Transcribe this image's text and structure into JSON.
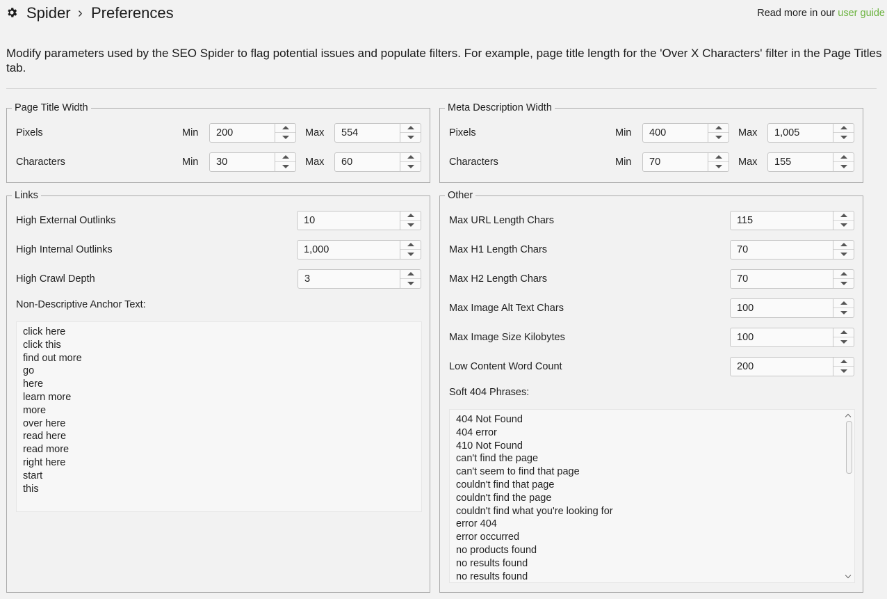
{
  "header": {
    "crumb_root": "Spider",
    "crumb_separator": "›",
    "crumb_page": "Preferences",
    "read_more_prefix": "Read more in our",
    "read_more_link": "user guide",
    "link_color": "#6cb33f"
  },
  "description": "Modify parameters used by the SEO Spider to flag potential issues and populate filters. For example, page title length for the 'Over X Characters' filter in the Page Titles tab.",
  "page_title_width": {
    "title": "Page Title Width",
    "rows": [
      {
        "label": "Pixels",
        "min_label": "Min",
        "min": "200",
        "max_label": "Max",
        "max": "554"
      },
      {
        "label": "Characters",
        "min_label": "Min",
        "min": "30",
        "max_label": "Max",
        "max": "60"
      }
    ]
  },
  "meta_description_width": {
    "title": "Meta Description Width",
    "rows": [
      {
        "label": "Pixels",
        "min_label": "Min",
        "min": "400",
        "max_label": "Max",
        "max": "1,005"
      },
      {
        "label": "Characters",
        "min_label": "Min",
        "min": "70",
        "max_label": "Max",
        "max": "155"
      }
    ]
  },
  "links": {
    "title": "Links",
    "fields": [
      {
        "label": "High External Outlinks",
        "value": "10"
      },
      {
        "label": "High Internal Outlinks",
        "value": "1,000"
      },
      {
        "label": "High Crawl Depth",
        "value": "3"
      }
    ],
    "anchor_label": "Non-Descriptive Anchor Text:",
    "anchor_text": [
      "click here",
      "click this",
      "find out more",
      "go",
      "here",
      "learn more",
      "more",
      "over here",
      "read here",
      "read more",
      "right here",
      "start",
      "this"
    ]
  },
  "other": {
    "title": "Other",
    "fields": [
      {
        "label": "Max URL Length Chars",
        "value": "115"
      },
      {
        "label": "Max H1 Length Chars",
        "value": "70"
      },
      {
        "label": "Max H2 Length Chars",
        "value": "70"
      },
      {
        "label": "Max Image Alt Text Chars",
        "value": "100"
      },
      {
        "label": "Max Image Size Kilobytes",
        "value": "100"
      },
      {
        "label": "Low Content Word Count",
        "value": "200"
      }
    ],
    "soft404_label": "Soft 404 Phrases:",
    "soft404_phrases": [
      "404 Not Found",
      "404 error",
      "410 Not Found",
      "can't find the page",
      "can't seem to find that page",
      "couldn't find that page",
      "couldn't find the page",
      "couldn't find what you're looking for",
      "error 404",
      "error occurred",
      "no products found",
      "no results found",
      "no results found"
    ]
  }
}
